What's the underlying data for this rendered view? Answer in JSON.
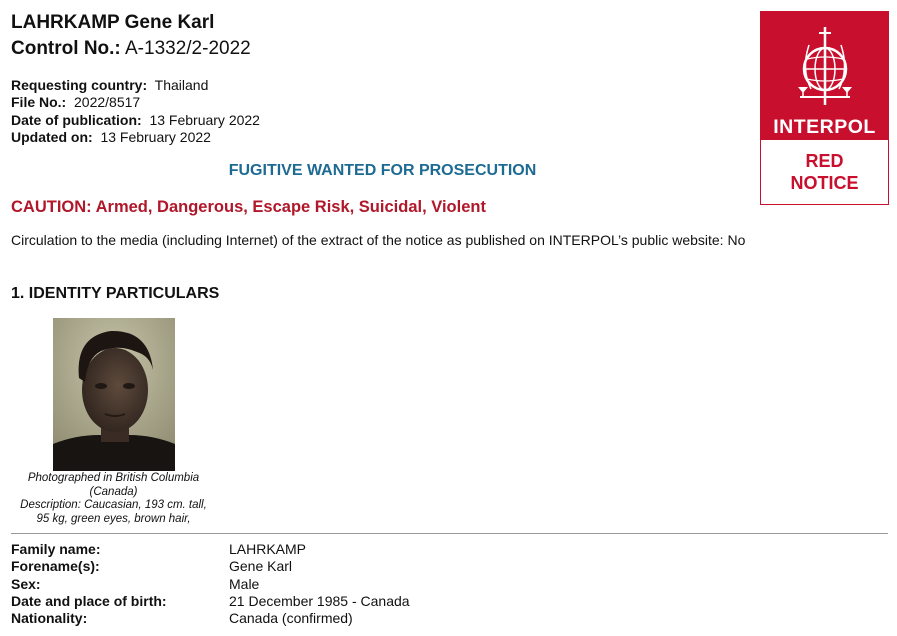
{
  "header": {
    "name": "LAHRKAMP Gene Karl",
    "control_label": "Control No.:",
    "control_value": "A-1332/2-2022"
  },
  "meta": [
    {
      "label": "Requesting country:",
      "value": "Thailand"
    },
    {
      "label": "File No.:",
      "value": "2022/8517"
    },
    {
      "label": "Date of publication:",
      "value": "13 February 2022"
    },
    {
      "label": "Updated on:",
      "value": "13 February 2022"
    }
  ],
  "notice_type": "FUGITIVE WANTED FOR PROSECUTION",
  "caution": "CAUTION:  Armed, Dangerous, Escape Risk, Suicidal, Violent",
  "circulation": "Circulation to the media (including Internet) of the extract of the notice as published on INTERPOL’s public website: No",
  "section_title": "1. IDENTITY PARTICULARS",
  "photo_caption": {
    "line1": "Photographed in British Columbia",
    "line2": "(Canada)",
    "line3": "Description: Caucasian, 193 cm. tall,",
    "line4": "95 kg, green eyes, brown hair,"
  },
  "identity": [
    {
      "label": "Family name:",
      "value": "LAHRKAMP"
    },
    {
      "label": "Forename(s):",
      "value": "Gene Karl"
    },
    {
      "label": "Sex:",
      "value": "Male"
    },
    {
      "label": "Date and place of birth:",
      "value": "21 December 1985 - Canada"
    },
    {
      "label": "Nationality:",
      "value": "Canada (confirmed)"
    }
  ],
  "badge": {
    "org": "INTERPOL",
    "line1": "RED",
    "line2": "NOTICE",
    "color": "#c8102e"
  }
}
